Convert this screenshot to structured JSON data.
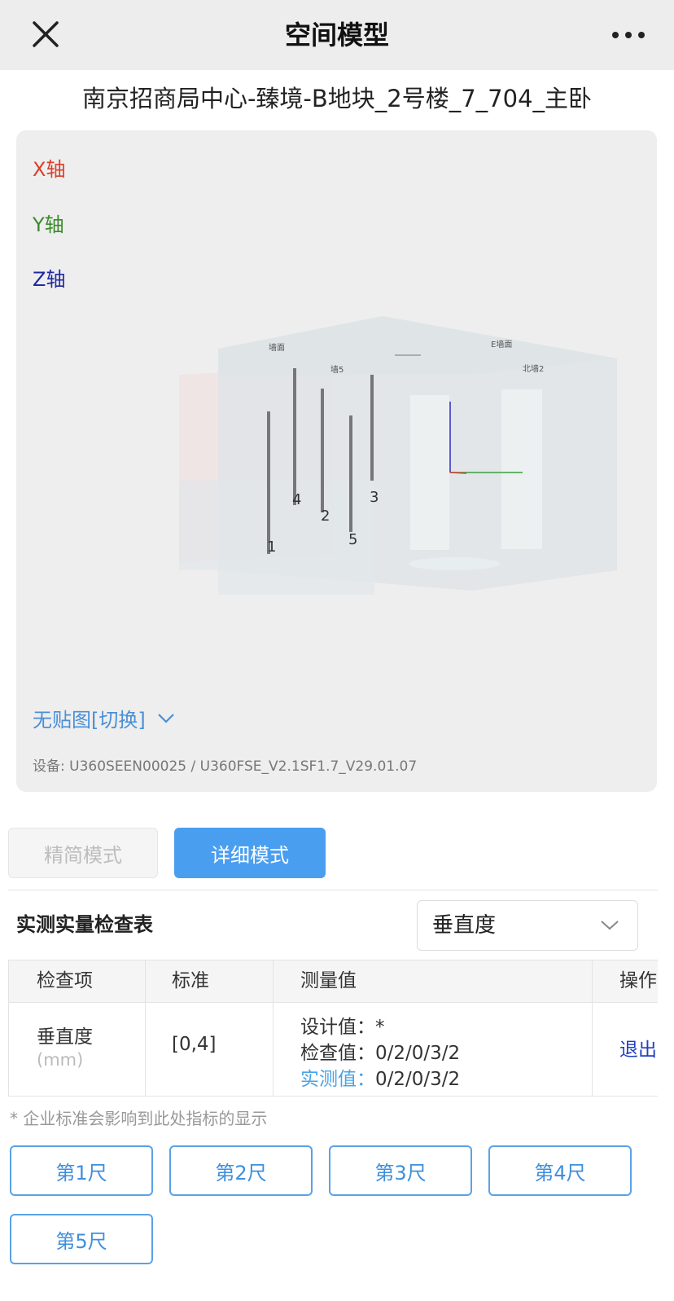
{
  "header": {
    "title": "空间模型"
  },
  "room_title": "南京招商局中心-臻境-B地块_2号楼_7_704_主卧",
  "model": {
    "axis_x": "X轴",
    "axis_y": "Y轴",
    "axis_z": "Z轴",
    "wall_labels": {
      "wall_a": "墙面",
      "wall_b": "E墙面",
      "wall_c": "北墙2",
      "wall_d": "墙5"
    },
    "rulers": [
      {
        "label": "1"
      },
      {
        "label": "2"
      },
      {
        "label": "3"
      },
      {
        "label": "4"
      },
      {
        "label": "5"
      }
    ],
    "texture_toggle": "无贴图[切换]",
    "device_info": "设备: U360SEEN00025 / U360FSE_V2.1SF1.7_V29.01.07",
    "colors": {
      "axis_x": "#d8402b",
      "axis_y": "#3b8a2a",
      "axis_z": "#1f2aa0"
    }
  },
  "modes": {
    "simple": "精简模式",
    "detail": "详细模式"
  },
  "check": {
    "title": "实测实量检查表",
    "selected": "垂直度"
  },
  "table": {
    "headers": [
      "检查项",
      "标准",
      "测量值",
      "操作"
    ],
    "row": {
      "item": "垂直度",
      "unit": "(mm)",
      "standard": "[0,4]",
      "design_label": "设计值：",
      "design_value": "*",
      "check_label": "检查值：",
      "check_value": "0/2/0/3/2",
      "measured_label": "实测值：",
      "measured_value": "0/2/0/3/2",
      "action": "退出"
    }
  },
  "footnote": "* 企业标准会影响到此处指标的显示",
  "ruler_buttons": [
    "第1尺",
    "第2尺",
    "第3尺",
    "第4尺",
    "第5尺"
  ]
}
